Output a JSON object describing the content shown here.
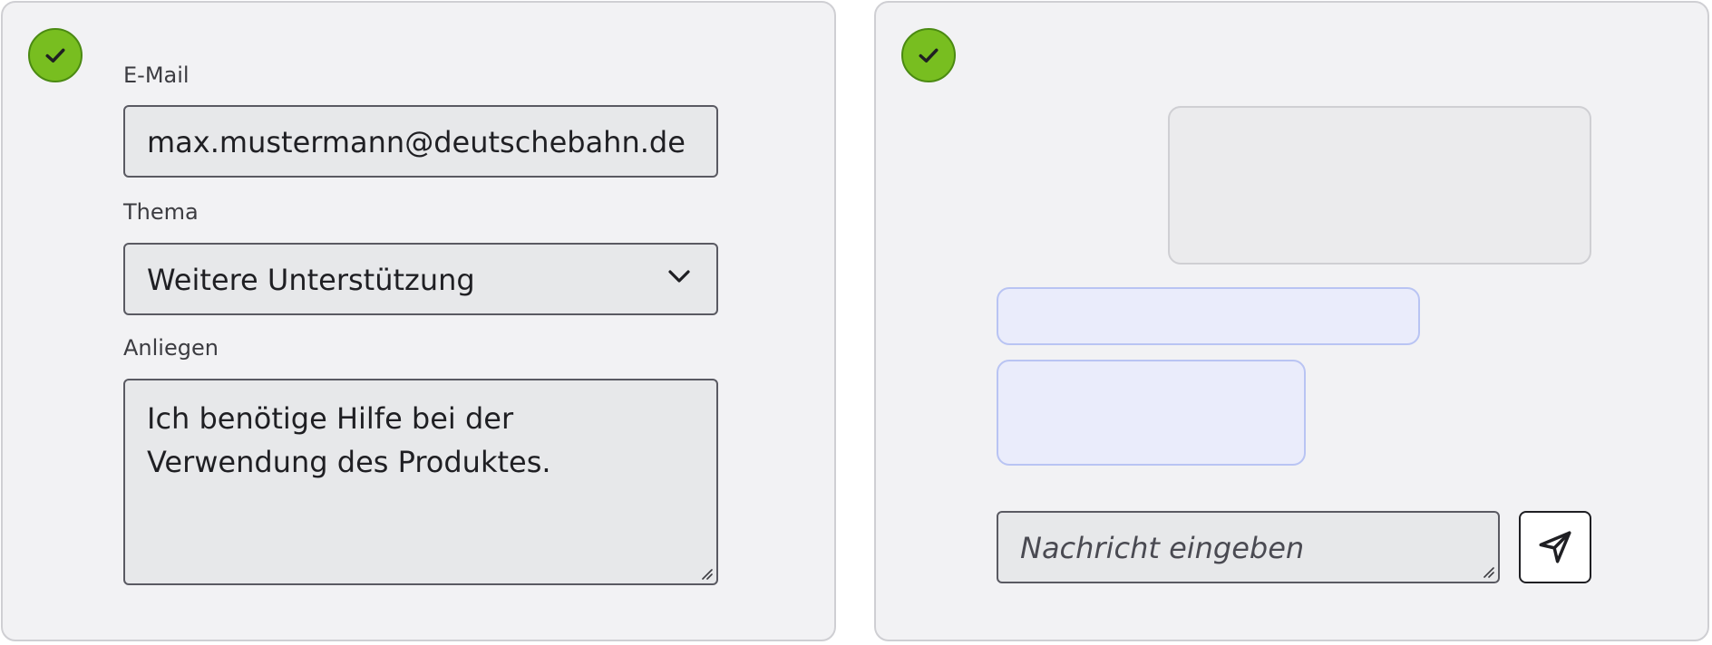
{
  "contact_form": {
    "status_icon": "check-icon",
    "email": {
      "label": "E-Mail",
      "value": "max.mustermann@deutschebahn.de"
    },
    "topic": {
      "label": "Thema",
      "selected": "Weitere Unterstützung",
      "icon": "chevron-down-icon"
    },
    "request": {
      "label": "Anliegen",
      "value": "Ich benötige Hilfe bei der Verwendung des Produktes."
    }
  },
  "chat": {
    "status_icon": "check-icon",
    "message_input": {
      "placeholder": "Nachricht eingeben"
    },
    "send_button": {
      "icon": "send-icon"
    }
  },
  "colors": {
    "success": "#78be20",
    "panel_background": "#f2f2f4",
    "input_background": "#e7e8ea",
    "bubble_incoming": "#ebebed",
    "bubble_outgoing": "#eaecfb"
  }
}
